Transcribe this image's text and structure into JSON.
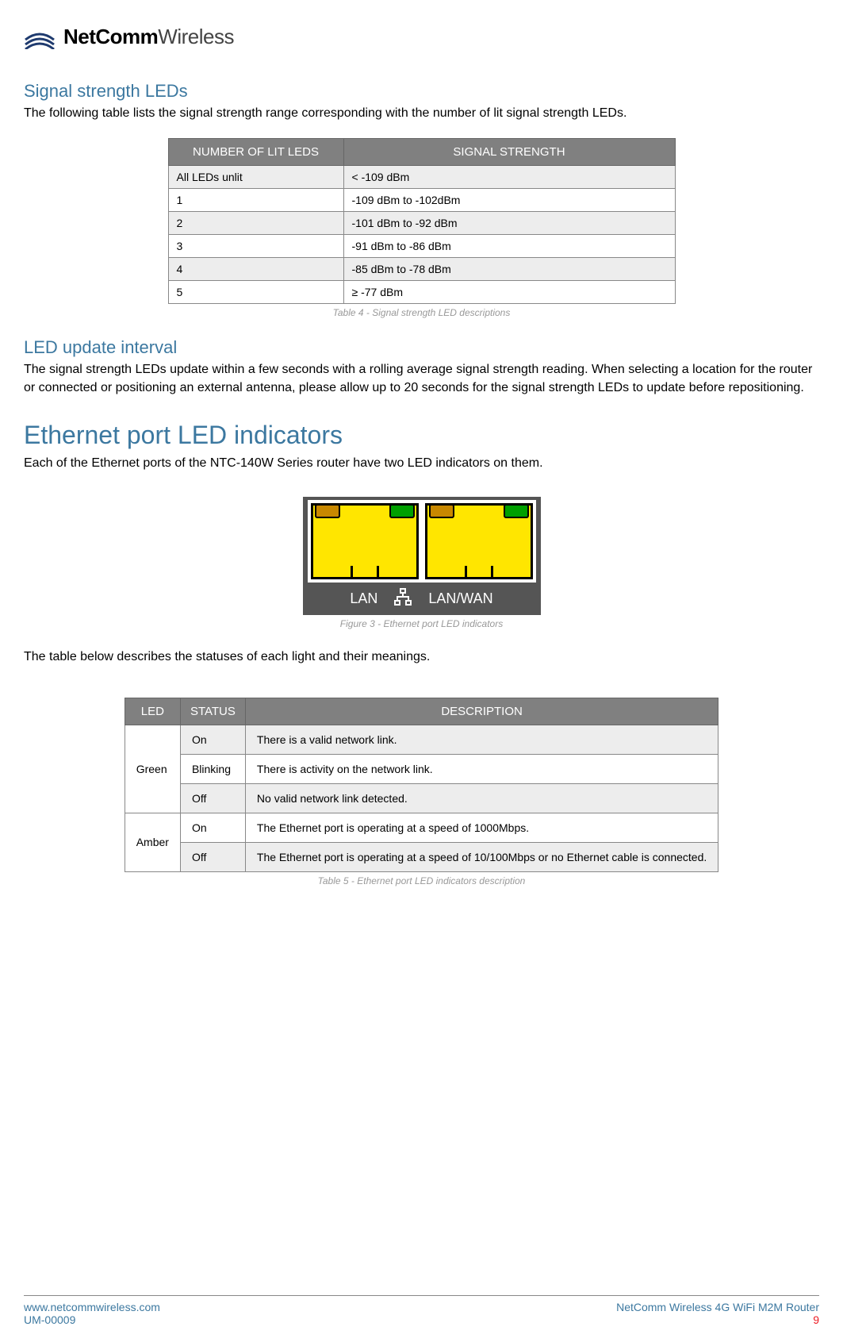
{
  "brand": {
    "bold": "NetComm",
    "light": "Wireless"
  },
  "section1": {
    "heading": "Signal strength LEDs",
    "intro": "The following table lists the signal strength range corresponding with the number of lit signal strength LEDs."
  },
  "table1": {
    "head": {
      "col1": "NUMBER OF LIT LEDS",
      "col2": "SIGNAL STRENGTH"
    },
    "rows": [
      {
        "c1": "All LEDs unlit",
        "c2": "< -109 dBm"
      },
      {
        "c1": "1",
        "c2": "-109 dBm to -102dBm"
      },
      {
        "c1": "2",
        "c2": "-101 dBm to -92 dBm"
      },
      {
        "c1": "3",
        "c2": "-91 dBm to -86 dBm"
      },
      {
        "c1": "4",
        "c2": "-85 dBm to -78 dBm"
      },
      {
        "c1": "5",
        "c2": "≥ -77 dBm"
      }
    ],
    "caption": "Table 4 - Signal strength LED descriptions"
  },
  "section2": {
    "heading": "LED update interval",
    "body": "The signal strength LEDs update within a few seconds with a rolling average signal strength reading. When selecting a location for the router or connected or positioning an external antenna, please allow up to 20 seconds for the signal strength LEDs to update before repositioning."
  },
  "section3": {
    "heading": "Ethernet port LED indicators",
    "intro": "Each of the Ethernet ports of the NTC-140W Series router have two LED indicators on them."
  },
  "figure": {
    "lan": "LAN",
    "lanwan": "LAN/WAN",
    "caption": "Figure 3 - Ethernet port LED indicators"
  },
  "section4": {
    "intro": "The table below describes the statuses of each light and their meanings."
  },
  "table2": {
    "head": {
      "c1": "LED",
      "c2": "STATUS",
      "c3": "DESCRIPTION"
    },
    "groups": [
      {
        "led": "Green",
        "rows": [
          {
            "status": "On",
            "desc": "There is a valid network link."
          },
          {
            "status": "Blinking",
            "desc": "There is activity on the network link."
          },
          {
            "status": "Off",
            "desc": "No valid network link detected."
          }
        ]
      },
      {
        "led": "Amber",
        "rows": [
          {
            "status": "On",
            "desc": "The Ethernet port is operating at a speed of 1000Mbps."
          },
          {
            "status": "Off",
            "desc": "The Ethernet port is operating at a speed of 10/100Mbps or no Ethernet cable is connected."
          }
        ]
      }
    ],
    "caption": "Table 5 - Ethernet port LED indicators description"
  },
  "footer": {
    "url": "www.netcommwireless.com",
    "docref": "UM-00009",
    "title": "NetComm Wireless 4G WiFi M2M Router",
    "page": "9"
  }
}
